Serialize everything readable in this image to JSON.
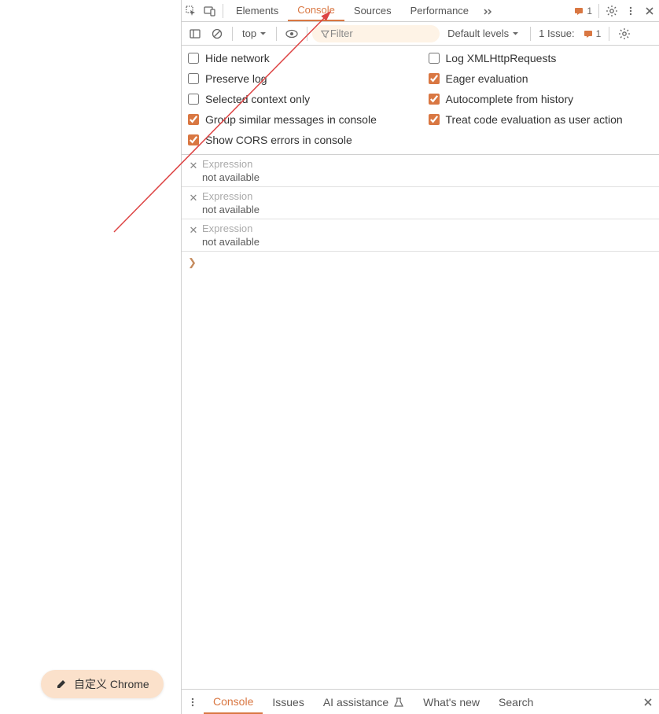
{
  "topTabs": {
    "elements": "Elements",
    "console": "Console",
    "sources": "Sources",
    "performance": "Performance"
  },
  "topBadges": {
    "messages": "1",
    "issuesLabel": "1 Issue:",
    "issuesCount": "1"
  },
  "toolbar": {
    "context": "top",
    "filterPlaceholder": "Filter",
    "levels": "Default levels"
  },
  "settings": {
    "hideNetwork": "Hide network",
    "logXhr": "Log XMLHttpRequests",
    "preserveLog": "Preserve log",
    "eagerEval": "Eager evaluation",
    "selectedContext": "Selected context only",
    "autocomplete": "Autocomplete from history",
    "groupSimilar": "Group similar messages in console",
    "treatCodeEval": "Treat code evaluation as user action",
    "showCors": "Show CORS errors in console"
  },
  "expressions": [
    {
      "label": "Expression",
      "value": "not available"
    },
    {
      "label": "Expression",
      "value": "not available"
    },
    {
      "label": "Expression",
      "value": "not available"
    }
  ],
  "drawer": {
    "console": "Console",
    "issues": "Issues",
    "ai": "AI assistance",
    "whatsnew": "What's new",
    "search": "Search"
  },
  "customPill": "自定义 Chrome"
}
